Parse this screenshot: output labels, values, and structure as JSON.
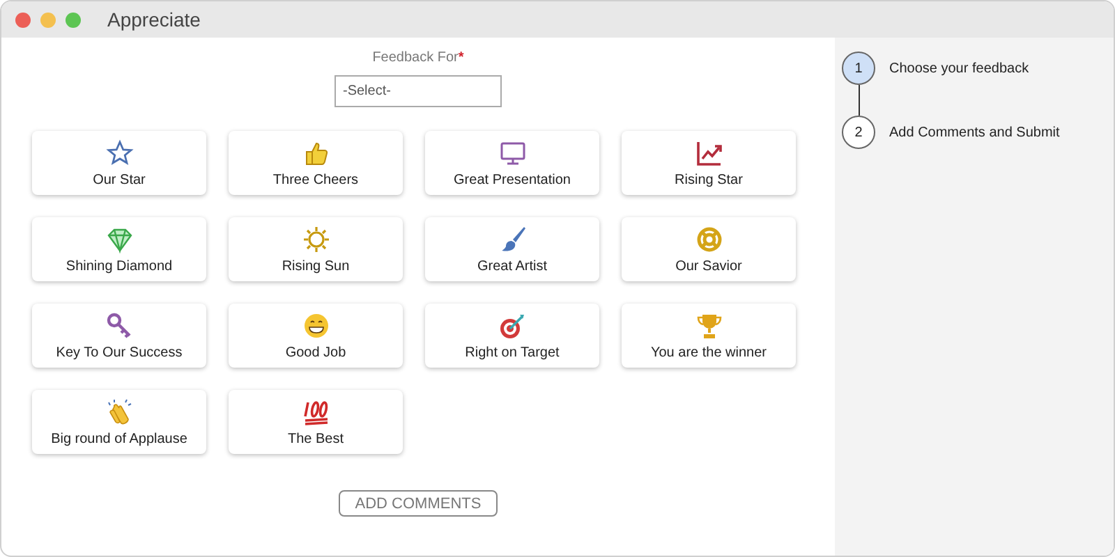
{
  "window": {
    "title": "Appreciate"
  },
  "feedback_field": {
    "label": "Feedback For",
    "required_mark": "*",
    "placeholder": "-Select-"
  },
  "badges": [
    {
      "label": "Our Star",
      "kind": "star"
    },
    {
      "label": "Three Cheers",
      "kind": "thumbs"
    },
    {
      "label": "Great Presentation",
      "kind": "monitor"
    },
    {
      "label": "Rising Star",
      "kind": "chart"
    },
    {
      "label": "Shining Diamond",
      "kind": "diamond"
    },
    {
      "label": "Rising Sun",
      "kind": "sun"
    },
    {
      "label": "Great Artist",
      "kind": "brush"
    },
    {
      "label": "Our Savior",
      "kind": "lifebuoy"
    },
    {
      "label": "Key To Our Success",
      "kind": "key"
    },
    {
      "label": "Good Job",
      "kind": "grin"
    },
    {
      "label": "Right on Target",
      "kind": "target"
    },
    {
      "label": "You are the winner",
      "kind": "trophy"
    },
    {
      "label": "Big round of Applause",
      "kind": "clap"
    },
    {
      "label": "The Best",
      "kind": "hundred"
    }
  ],
  "add_comments_button": "ADD COMMENTS",
  "steps": [
    {
      "number": "1",
      "label": "Choose your feedback",
      "selected": true
    },
    {
      "number": "2",
      "label": "Add Comments and Submit",
      "selected": false
    }
  ]
}
